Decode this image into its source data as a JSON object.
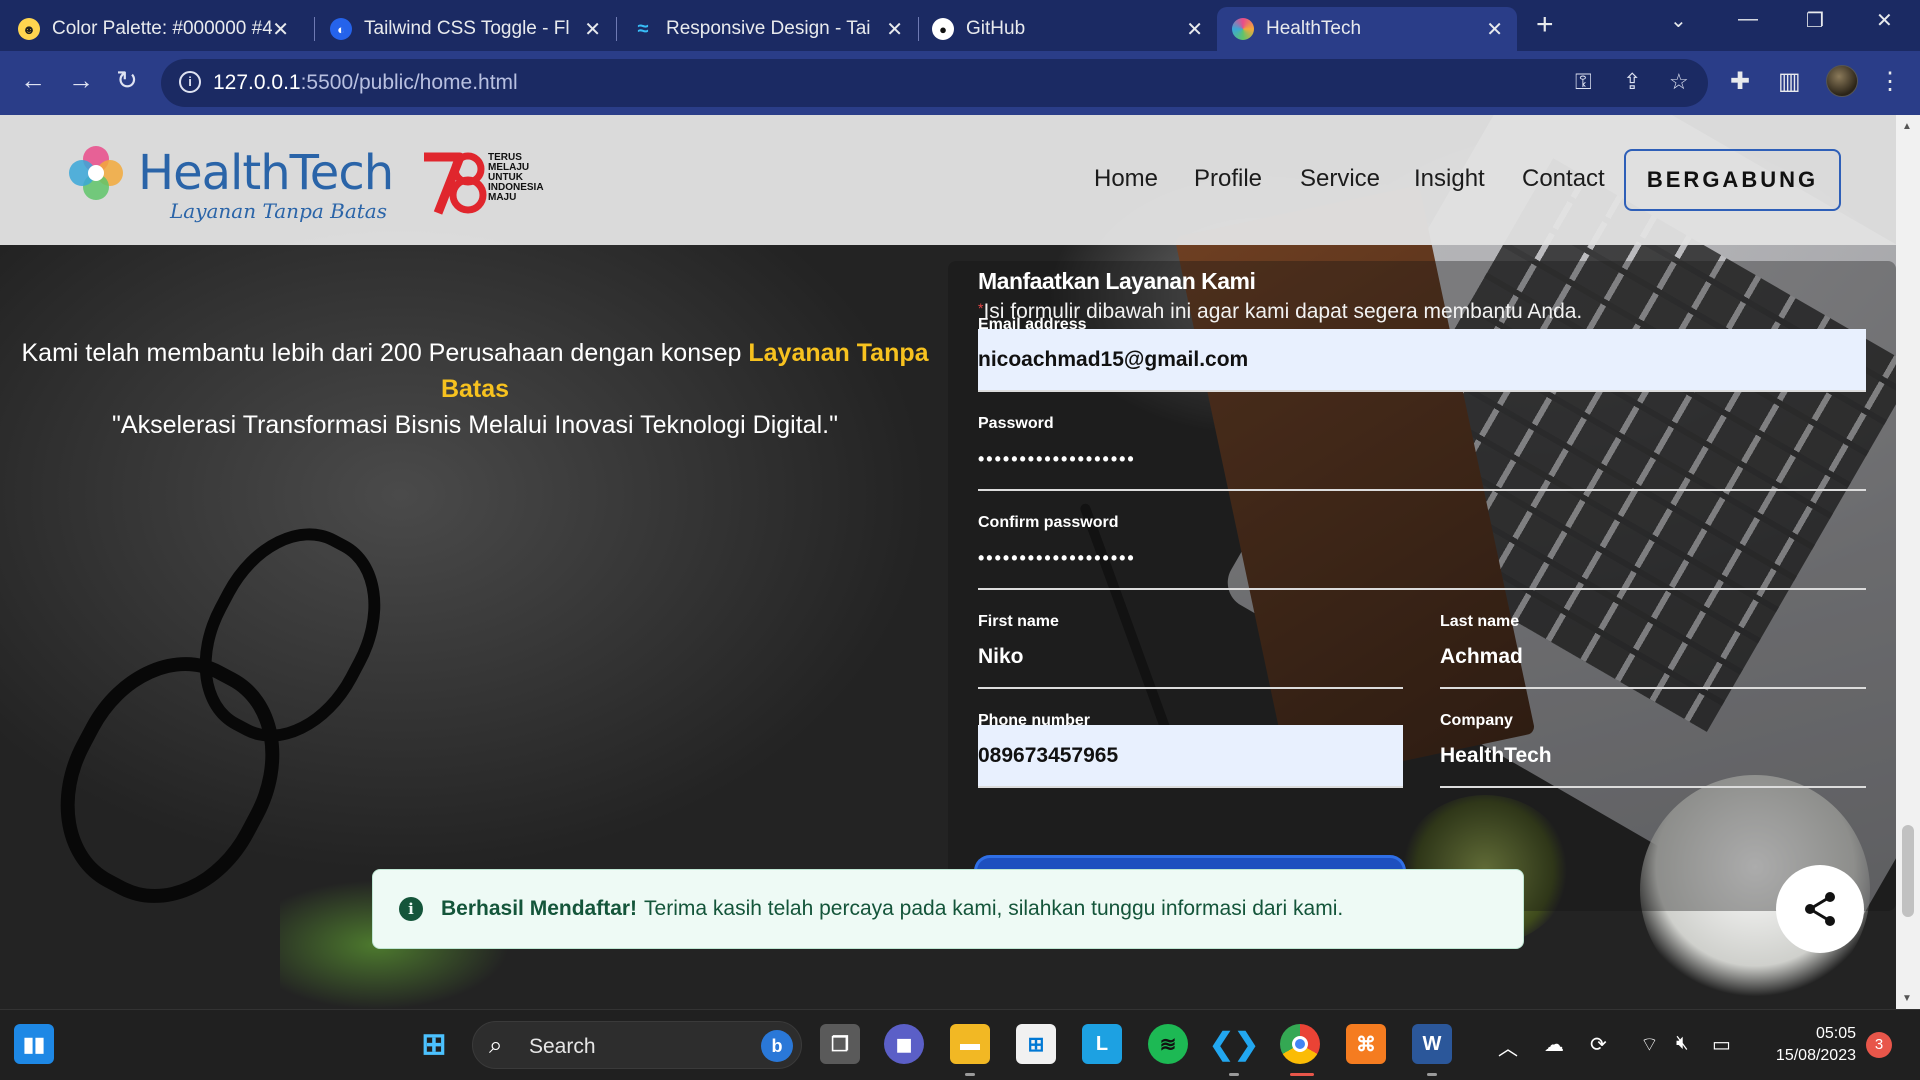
{
  "browser": {
    "tabs": [
      {
        "title": "Color Palette: #000000 #4",
        "active": false
      },
      {
        "title": "Tailwind CSS Toggle - Flow",
        "active": false
      },
      {
        "title": "Responsive Design - Tailw",
        "active": false
      },
      {
        "title": "GitHub",
        "active": false
      },
      {
        "title": "HealthTech",
        "active": true
      }
    ],
    "url_host": "127.0.0.1",
    "url_path": ":5500/public/home.html"
  },
  "site": {
    "logo_word": "HealthTech",
    "logo_tagline": "Layanan Tanpa Batas",
    "badge_text": "TERUS MELAJU UNTUK INDONESIA MAJU",
    "nav": [
      "Home",
      "Profile",
      "Service",
      "Insight",
      "Contact"
    ],
    "cta": "BERGABUNG"
  },
  "hero": {
    "line1_prefix": "Kami telah membantu lebih dari 200 Perusahaan dengan konsep ",
    "line1_highlight": "Layanan Tanpa Batas",
    "quote": "\"Akselerasi Transformasi Bisnis Melalui Inovasi Teknologi Digital.\""
  },
  "form": {
    "title": "Manfaatkan Layanan Kami",
    "subtitle": "Isi formulir dibawah ini agar kami dapat segera membantu Anda.",
    "email_label": "Email address",
    "email_value": "nicoachmad15@gmail.com",
    "password_label": "Password",
    "password_value": "•••••••••••••••••••",
    "confirm_label": "Confirm password",
    "confirm_value": "•••••••••••••••••••",
    "first_name_label": "First name",
    "first_name_value": "Niko",
    "last_name_label": "Last name",
    "last_name_value": "Achmad",
    "phone_label": "Phone number",
    "phone_value": "089673457965",
    "company_label": "Company",
    "company_value": "HealthTech"
  },
  "toast": {
    "bold": "Berhasil Mendaftar!",
    "message": "Terima kasih telah percaya pada kami, silahkan tunggu informasi dari kami."
  },
  "taskbar": {
    "search_label": "Search",
    "time": "05:05",
    "date": "15/08/2023",
    "notification_count": "3"
  },
  "colors": {
    "highlight": "#f7c21f",
    "brand_blue": "#2a64a8",
    "toast_text": "#14553a"
  }
}
